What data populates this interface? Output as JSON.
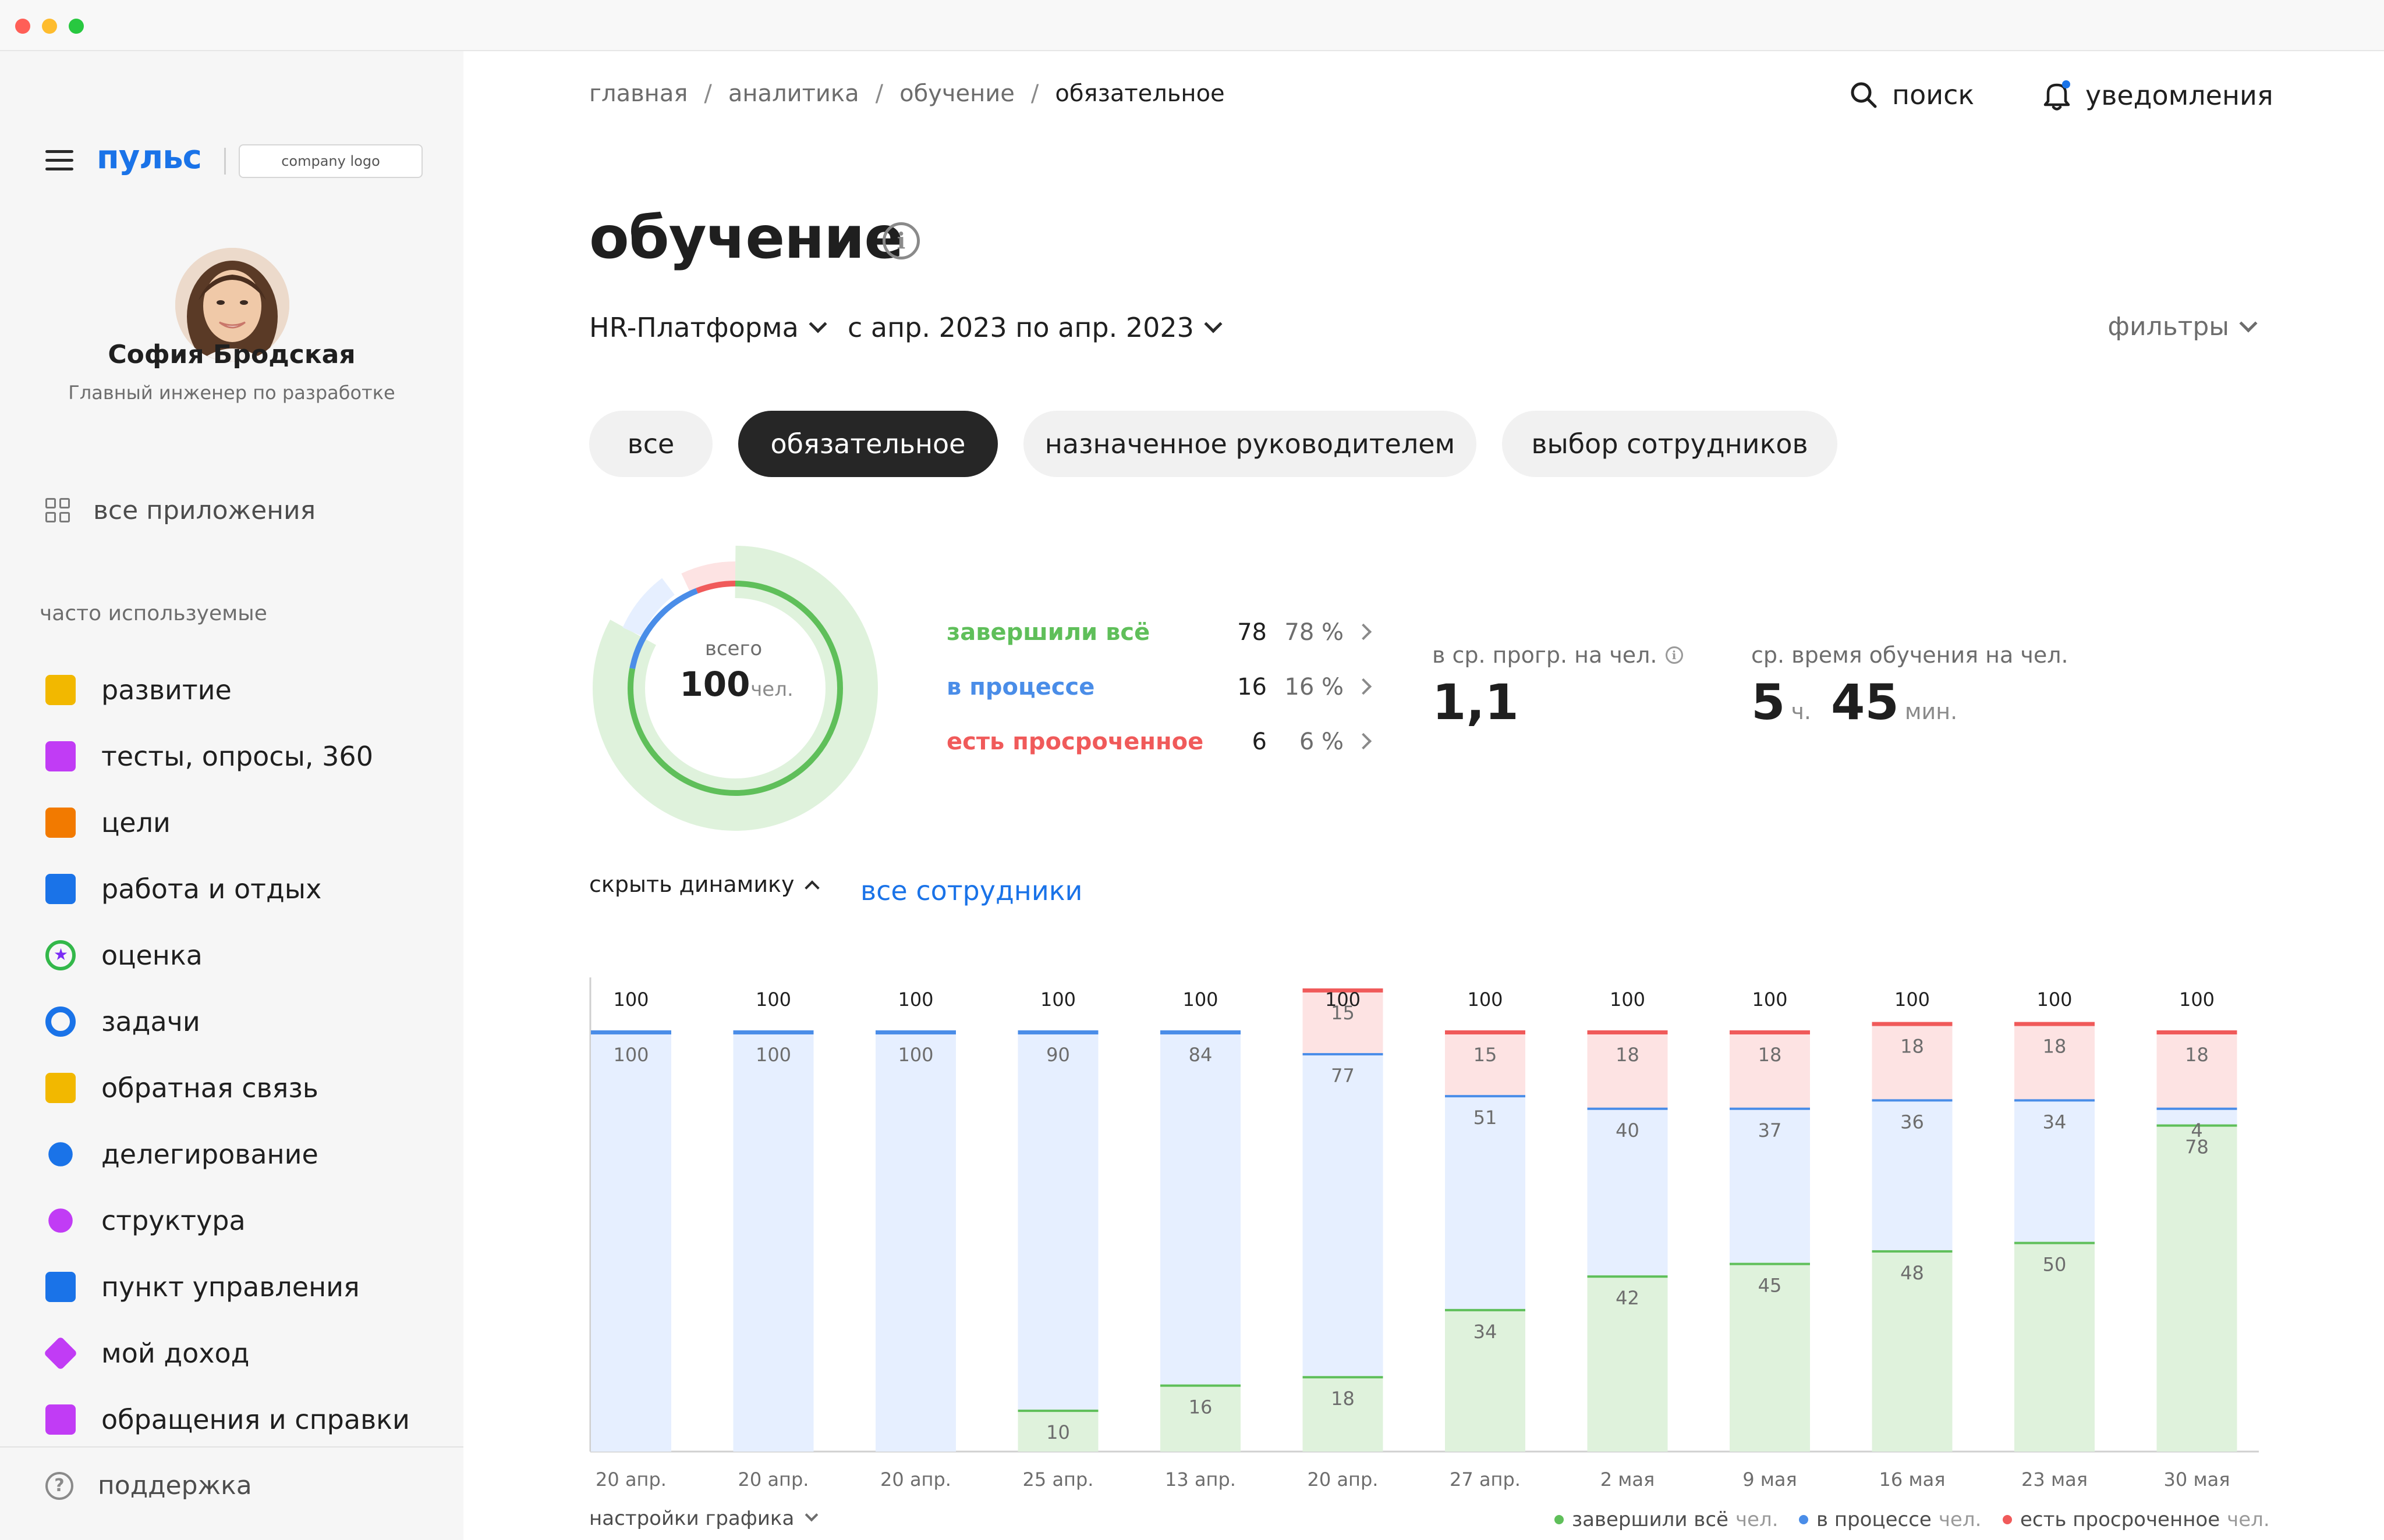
{
  "brand": {
    "name": "пульс",
    "company_logo": "company logo"
  },
  "user": {
    "name": "София Бродская",
    "role": "Главный инженер по разработке"
  },
  "sidebar": {
    "all_apps": "все приложения",
    "frequent_label": "часто используемые",
    "items": [
      {
        "label": "развитие",
        "icon": "book-icon",
        "color": "#f2b800"
      },
      {
        "label": "тесты, опросы, 360",
        "icon": "checkbox-icon",
        "color": "#c13cf5"
      },
      {
        "label": "цели",
        "icon": "flag-icon",
        "color": "#f27a00"
      },
      {
        "label": "работа и отдых",
        "icon": "briefcase-icon",
        "color": "#1a73e8"
      },
      {
        "label": "оценка",
        "icon": "star-icon",
        "color": "#7b2cf5"
      },
      {
        "label": "задачи",
        "icon": "target-icon",
        "color": "#1a73e8"
      },
      {
        "label": "обратная связь",
        "icon": "feedback-icon",
        "color": "#f2b800"
      },
      {
        "label": "делегирование",
        "icon": "people-icon",
        "color": "#1a73e8"
      },
      {
        "label": "структура",
        "icon": "structure-icon",
        "color": "#c13cf5"
      },
      {
        "label": "пункт управления",
        "icon": "wrench-icon",
        "color": "#1a73e8"
      },
      {
        "label": "мой доход",
        "icon": "diamond-icon",
        "color": "#c13cf5"
      },
      {
        "label": "обращения и справки",
        "icon": "document-icon",
        "color": "#c13cf5"
      }
    ],
    "support": "поддержка"
  },
  "breadcrumb": [
    "главная",
    "аналитика",
    "обучение",
    "обязательное"
  ],
  "header": {
    "search": "поиск",
    "notifications": "уведомления"
  },
  "page": {
    "title": "обучение",
    "platform": "HR-Платформа",
    "period": "с апр. 2023 по апр. 2023",
    "filters": "фильтры",
    "tabs": [
      "все",
      "обязательное",
      "назначенное руководителем",
      "выбор сотрудников"
    ],
    "active_tab": 1
  },
  "summary": {
    "total_label": "всего",
    "total": "100",
    "total_unit": "чел.",
    "rows": [
      {
        "label": "завершили всё",
        "count": "78",
        "pct": "78 %",
        "color": "#5fbf5a"
      },
      {
        "label": "в процессе",
        "count": "16",
        "pct": "16 %",
        "color": "#4a8de8"
      },
      {
        "label": "есть просроченное",
        "count": "6",
        "pct": "6 %",
        "color": "#f05a5a"
      }
    ],
    "avg_progress_label": "в ср. прогр. на чел.",
    "avg_progress": "1,1",
    "avg_time_label": "ср. время обучения на чел.",
    "avg_time_hours": "5",
    "hours_unit": "ч.",
    "avg_time_minutes": "45",
    "minutes_unit": "мин."
  },
  "dynamics": {
    "hide_label": "скрыть динамику",
    "all_employees": "все сотрудники"
  },
  "chart_data": {
    "type": "bar",
    "stacked": true,
    "categories": [
      "20 апр.",
      "20 апр.",
      "20 апр.",
      "25 апр.",
      "13 апр.",
      "20 апр.",
      "27 апр.",
      "2 мая",
      "9 мая",
      "16 мая",
      "23 мая",
      "30 мая"
    ],
    "totals": [
      100,
      100,
      100,
      100,
      100,
      100,
      100,
      100,
      100,
      100,
      100,
      100
    ],
    "series": [
      {
        "name": "завершили всё",
        "values": [
          0,
          0,
          0,
          10,
          16,
          18,
          34,
          42,
          45,
          48,
          50,
          78
        ],
        "color": "#5fbf5a",
        "fill": "#dff2dc"
      },
      {
        "name": "в процессе",
        "values": [
          100,
          100,
          100,
          90,
          84,
          77,
          51,
          40,
          37,
          36,
          34,
          4
        ],
        "color": "#4a8de8",
        "fill": "#e6efff"
      },
      {
        "name": "есть просроченное",
        "values": [
          0,
          0,
          0,
          0,
          0,
          15,
          15,
          18,
          18,
          18,
          18,
          18
        ],
        "color": "#f05a5a",
        "fill": "#fde3e3"
      }
    ],
    "legend_unit": "чел.",
    "ylim": [
      0,
      100
    ],
    "legend_position": "bottom-right",
    "settings_label": "настройки графика"
  }
}
